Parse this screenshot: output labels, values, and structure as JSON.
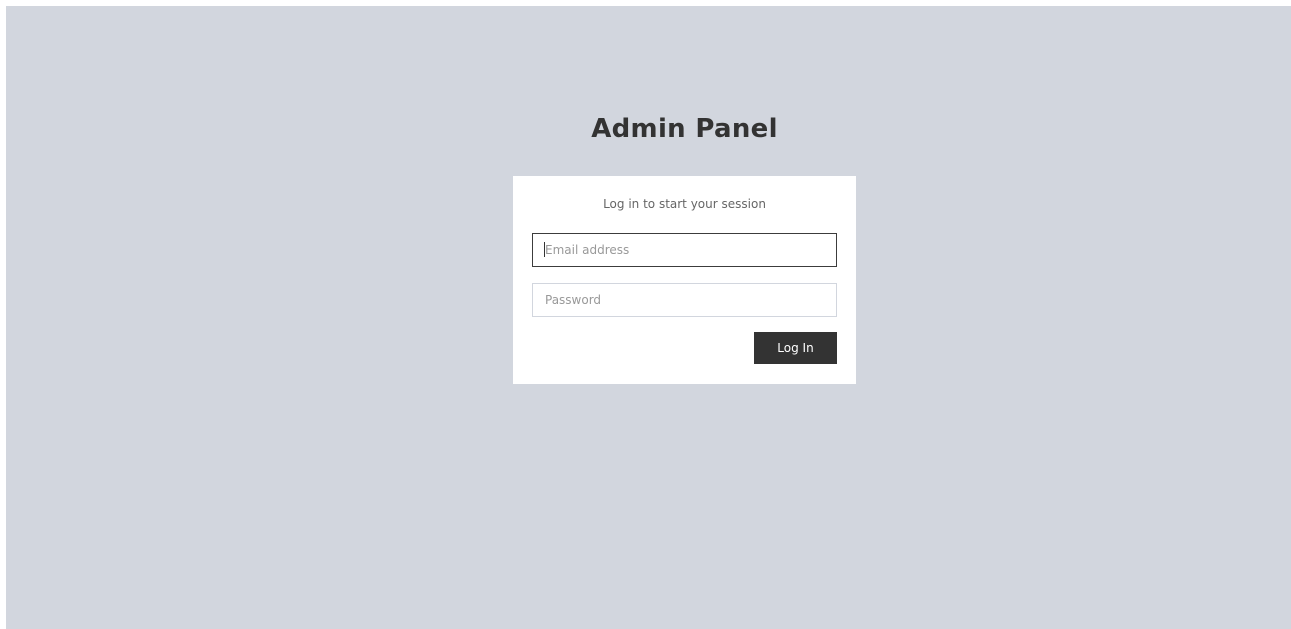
{
  "page": {
    "title": "Admin Panel"
  },
  "login": {
    "message": "Log in to start your session",
    "email": {
      "placeholder": "Email address",
      "value": ""
    },
    "password": {
      "placeholder": "Password",
      "value": ""
    },
    "submit_label": "Log In"
  },
  "colors": {
    "background": "#d2d6de",
    "panel": "#ffffff",
    "button": "#333333",
    "title_text": "#333333"
  }
}
